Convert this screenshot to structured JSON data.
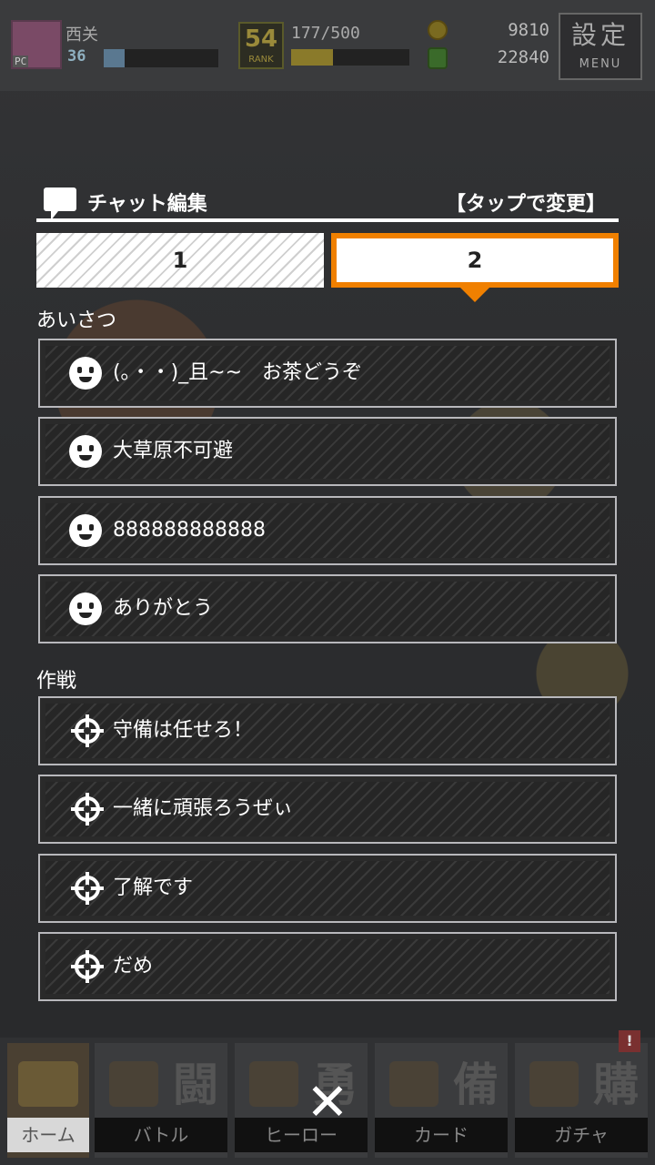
{
  "status": {
    "player_name": "西关",
    "player_tag": "PC",
    "level": "36",
    "level_progress": 0.18,
    "rank": "54",
    "rank_label": "RANK",
    "stamina": "177/500",
    "stamina_progress": 0.354,
    "coins": "9810",
    "gems": "22840",
    "menu_kanji": "設定",
    "menu_label": "MENU"
  },
  "panel": {
    "title": "チャット編集",
    "tap_hint": "【タップで変更】",
    "tabs": [
      {
        "label": "1",
        "active": false
      },
      {
        "label": "2",
        "active": true
      }
    ],
    "accent_color": "#f08000"
  },
  "sections": {
    "greeting": {
      "label": "あいさつ",
      "icon": "face-icon",
      "items": [
        "(｡・・)_且~~　お茶どうぞ",
        "大草原不可避",
        "888888888888",
        "ありがとう"
      ]
    },
    "tactics": {
      "label": "作戦",
      "icon": "crosshair-icon",
      "items": [
        "守備は任せろ！",
        "一緒に頑張ろうぜぃ",
        "了解です",
        "だめ"
      ]
    }
  },
  "bottom_nav": {
    "items": [
      {
        "label": "ホーム",
        "kanji": "",
        "icon": "home-icon"
      },
      {
        "label": "バトル",
        "kanji": "闘",
        "icon": "gamepad-icon"
      },
      {
        "label": "ヒーロー",
        "kanji": "勇",
        "icon": "hero-icon"
      },
      {
        "label": "カード",
        "kanji": "備",
        "icon": "cards-icon"
      },
      {
        "label": "ガチャ",
        "kanji": "購",
        "icon": "gacha-icon"
      }
    ],
    "alert_badge": "!",
    "close_glyph": "✕"
  }
}
